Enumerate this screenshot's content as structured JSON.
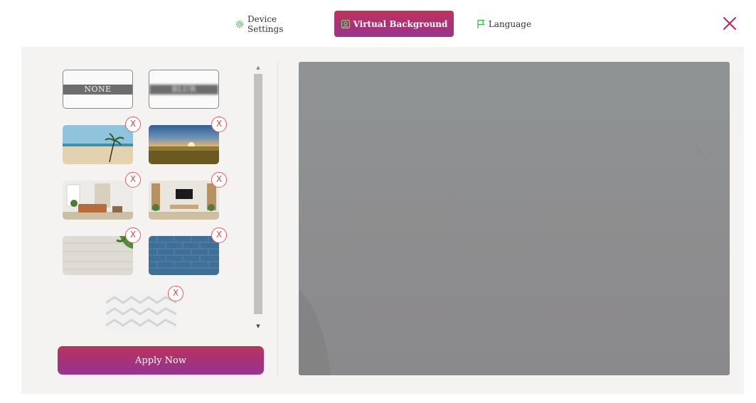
{
  "header": {
    "tabs": [
      {
        "label": "Device Settings",
        "icon": "gear-icon",
        "active": false
      },
      {
        "label": "Virtual Background",
        "icon": "user-image-icon",
        "active": true
      },
      {
        "label": "Language",
        "icon": "flag-icon",
        "active": false
      }
    ],
    "close_icon": "close-icon"
  },
  "backgrounds": {
    "none_label": "NONE",
    "blur_label": "BLUR",
    "remove_label": "X",
    "items": [
      {
        "name": "beach"
      },
      {
        "name": "sunset-field"
      },
      {
        "name": "living-room"
      },
      {
        "name": "tv-room"
      },
      {
        "name": "wood-leaves"
      },
      {
        "name": "blue-brick"
      },
      {
        "name": "white-geometric"
      }
    ]
  },
  "actions": {
    "apply_label": "Apply Now"
  },
  "colors": {
    "accent": "#a5327a",
    "accent_top": "#c0325a",
    "remove_red": "#e65a5a",
    "panel_bg": "#f5f3f2"
  }
}
